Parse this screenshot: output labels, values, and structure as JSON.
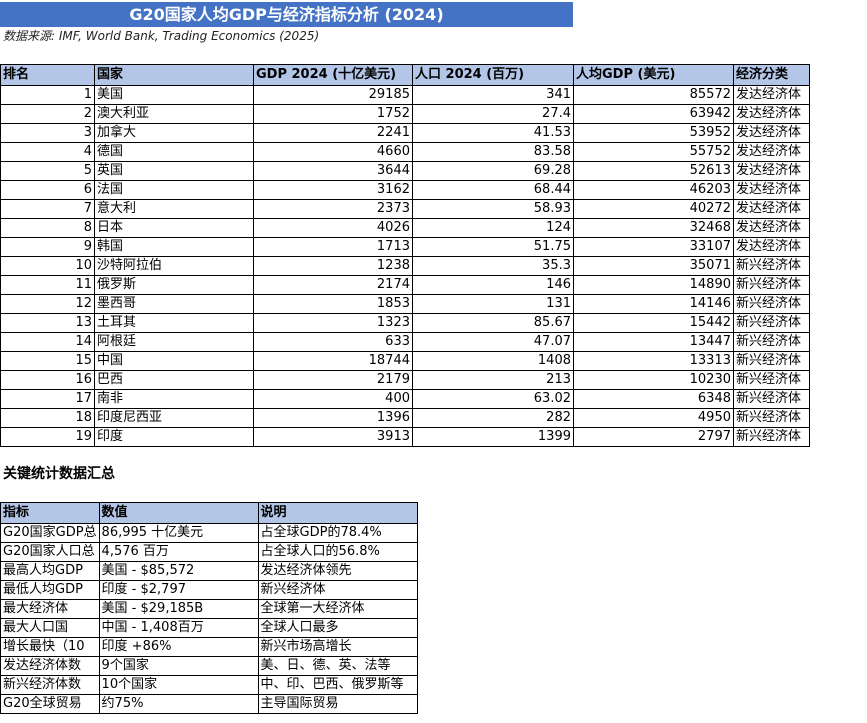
{
  "title": "G20国家人均GDP与经济指标分析 (2024)",
  "source": "数据来源: IMF, World Bank, Trading Economics (2025)",
  "main_table": {
    "headers": [
      "排名",
      "国家",
      "GDP 2024 (十亿美元)",
      "人口 2024 (百万)",
      "人均GDP (美元)",
      "经济分类"
    ],
    "rows": [
      [
        "1",
        "美国",
        "29185",
        "341",
        "85572",
        "发达经济体"
      ],
      [
        "2",
        "澳大利亚",
        "1752",
        "27.4",
        "63942",
        "发达经济体"
      ],
      [
        "3",
        "加拿大",
        "2241",
        "41.53",
        "53952",
        "发达经济体"
      ],
      [
        "4",
        "德国",
        "4660",
        "83.58",
        "55752",
        "发达经济体"
      ],
      [
        "5",
        "英国",
        "3644",
        "69.28",
        "52613",
        "发达经济体"
      ],
      [
        "6",
        "法国",
        "3162",
        "68.44",
        "46203",
        "发达经济体"
      ],
      [
        "7",
        "意大利",
        "2373",
        "58.93",
        "40272",
        "发达经济体"
      ],
      [
        "8",
        "日本",
        "4026",
        "124",
        "32468",
        "发达经济体"
      ],
      [
        "9",
        "韩国",
        "1713",
        "51.75",
        "33107",
        "发达经济体"
      ],
      [
        "10",
        "沙特阿拉伯",
        "1238",
        "35.3",
        "35071",
        "新兴经济体"
      ],
      [
        "11",
        "俄罗斯",
        "2174",
        "146",
        "14890",
        "新兴经济体"
      ],
      [
        "12",
        "墨西哥",
        "1853",
        "131",
        "14146",
        "新兴经济体"
      ],
      [
        "13",
        "土耳其",
        "1323",
        "85.67",
        "15442",
        "新兴经济体"
      ],
      [
        "14",
        "阿根廷",
        "633",
        "47.07",
        "13447",
        "新兴经济体"
      ],
      [
        "15",
        "中国",
        "18744",
        "1408",
        "13313",
        "新兴经济体"
      ],
      [
        "16",
        "巴西",
        "2179",
        "213",
        "10230",
        "新兴经济体"
      ],
      [
        "17",
        "南非",
        "400",
        "63.02",
        "6348",
        "新兴经济体"
      ],
      [
        "18",
        "印度尼西亚",
        "1396",
        "282",
        "4950",
        "新兴经济体"
      ],
      [
        "19",
        "印度",
        "3913",
        "1399",
        "2797",
        "新兴经济体"
      ]
    ]
  },
  "summary_title": "关键统计数据汇总",
  "summary_table": {
    "headers": [
      "指标",
      "数值",
      "说明"
    ],
    "rows": [
      [
        "G20国家GDP总",
        "86,995 十亿美元",
        "占全球GDP的78.4%"
      ],
      [
        "G20国家人口总",
        "4,576 百万",
        "占全球人口的56.8%"
      ],
      [
        "最高人均GDP",
        "美国 - $85,572",
        "发达经济体领先"
      ],
      [
        "最低人均GDP",
        "印度 - $2,797",
        "新兴经济体"
      ],
      [
        "最大经济体",
        "美国 - $29,185B",
        "全球第一大经济体"
      ],
      [
        "最大人口国",
        "中国 - 1,408百万",
        "全球人口最多"
      ],
      [
        "增长最快（10",
        "印度 +86%",
        "新兴市场高增长"
      ],
      [
        "发达经济体数",
        "9个国家",
        "美、日、德、英、法等"
      ],
      [
        "新兴经济体数",
        "10个国家",
        "中、印、巴西、俄罗斯等"
      ],
      [
        "G20全球贸易",
        "约75%",
        "主导国际贸易"
      ]
    ]
  }
}
